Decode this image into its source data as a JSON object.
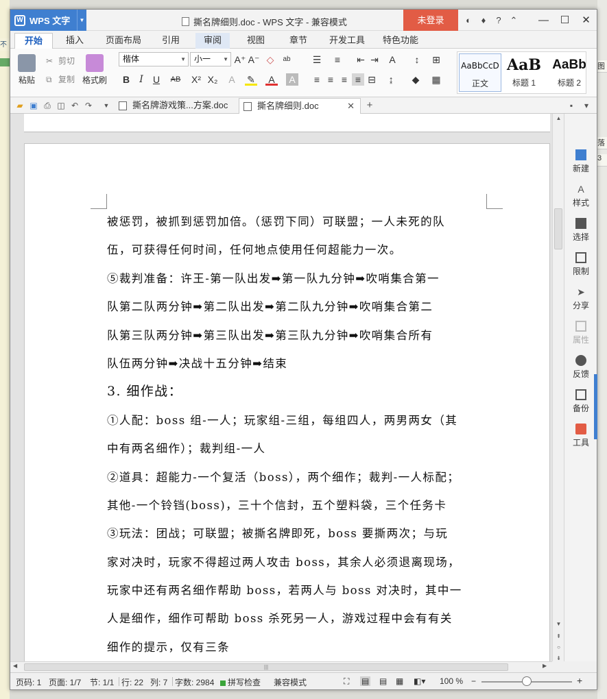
{
  "background": {
    "left_snippet": "不要",
    "right_snippets": [
      "图文",
      "落",
      "3"
    ]
  },
  "titlebar": {
    "app_button": "WPS 文字",
    "title": "撕名牌细则.doc - WPS 文字 - 兼容模式",
    "login": "未登录",
    "help": "?"
  },
  "menu_tabs": [
    "开始",
    "插入",
    "页面布局",
    "引用",
    "审阅",
    "视图",
    "章节",
    "开发工具",
    "特色功能"
  ],
  "ribbon": {
    "paste": "粘贴",
    "cut": "剪切",
    "copy": "复制",
    "format_painter": "格式刷",
    "font_name": "楷体",
    "font_size": "小一",
    "styles": [
      {
        "preview": "AaBbCcD",
        "name": "正文"
      },
      {
        "preview": "AaB",
        "name": "标题 1"
      },
      {
        "preview": "AaBb",
        "name": "标题 2"
      }
    ]
  },
  "doc_tabs": [
    {
      "label": "撕名牌游戏策...方案.doc",
      "active": false
    },
    {
      "label": "撕名牌细则.doc",
      "active": true
    }
  ],
  "document": {
    "lines": [
      "被惩罚，被抓到惩罚加倍。（惩罚下同）可联盟；一人未死的队",
      "伍，可获得任何时间，任何地点使用任何超能力一次。",
      "⑤裁判准备：许王-第一队出发➡第一队九分钟➡吹哨集合第一",
      "队第二队两分钟➡第二队出发➡第二队九分钟➡吹哨集合第二",
      "队第三队两分钟➡第三队出发➡第三队九分钟➡吹哨集合所有",
      "队伍两分钟➡决战十五分钟➡结束",
      "3. 细作战：",
      "①人配：boss 组-一人；玩家组-三组，每组四人，两男两女（其",
      "中有两名细作）；裁判组-一人",
      "②道具：超能力-一个复活（boss），两个细作；裁判-一人标配；",
      "其他-一个铃铛(boss)，三十个信封，五个塑料袋，三个任务卡",
      "③玩法：团战；可联盟；被撕名牌即死，boss 要撕两次；与玩",
      "家对决时，玩家不得超过两人攻击 boss，其余人必须退离现场，",
      "玩家中还有两名细作帮助 boss，若两人与 boss 对决时，其中一",
      "人是细作，细作可帮助 boss 杀死另一人，游戏过程中会有有关",
      "细作的提示，仅有三条"
    ]
  },
  "taskpane": [
    "新建",
    "样式",
    "选择",
    "限制",
    "分享",
    "属性",
    "反馈",
    "备份",
    "工具"
  ],
  "statusbar": {
    "page_no": "页码: 1",
    "pages": "页面: 1/7",
    "section": "节: 1/1",
    "row": "行: 22",
    "col": "列: 7",
    "word_count": "字数: 2984",
    "spell": "拼写检查",
    "mode": "兼容模式",
    "zoom": "100 %"
  },
  "colors": {
    "accent_blue": "#3f7fd0",
    "login_red": "#e25c45",
    "spell_green": "#3ba53b"
  }
}
